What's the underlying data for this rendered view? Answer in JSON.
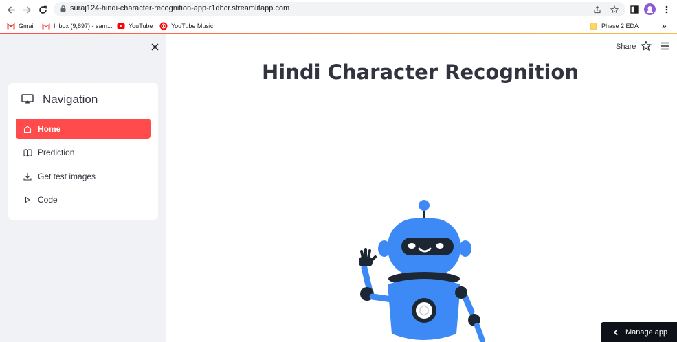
{
  "browser": {
    "url": "suraj124-hindi-character-recognition-app-r1dhcr.streamlitapp.com",
    "bookmarks": [
      {
        "label": "Gmail",
        "icon": "gmail-icon"
      },
      {
        "label": "Inbox (9,897) - sam...",
        "icon": "gmail-icon"
      },
      {
        "label": "YouTube",
        "icon": "youtube-icon"
      },
      {
        "label": "YouTube Music",
        "icon": "youtube-music-icon"
      },
      {
        "label": "Phase 2 EDA",
        "icon": "folder-icon"
      }
    ],
    "more_bookmarks": "»"
  },
  "sidebar": {
    "title": "Navigation",
    "items": [
      {
        "label": "Home",
        "icon": "home-icon",
        "active": true
      },
      {
        "label": "Prediction",
        "icon": "book-icon",
        "active": false
      },
      {
        "label": "Get test images",
        "icon": "download-icon",
        "active": false
      },
      {
        "label": "Code",
        "icon": "play-icon",
        "active": false
      }
    ]
  },
  "header": {
    "share_label": "Share"
  },
  "main": {
    "title": "Hindi Character Recognition"
  },
  "footer": {
    "manage_label": "Manage app"
  },
  "colors": {
    "accent": "#ff4b4b",
    "sidebar_bg": "#f0f2f6",
    "robot_blue": "#3d8af7"
  }
}
